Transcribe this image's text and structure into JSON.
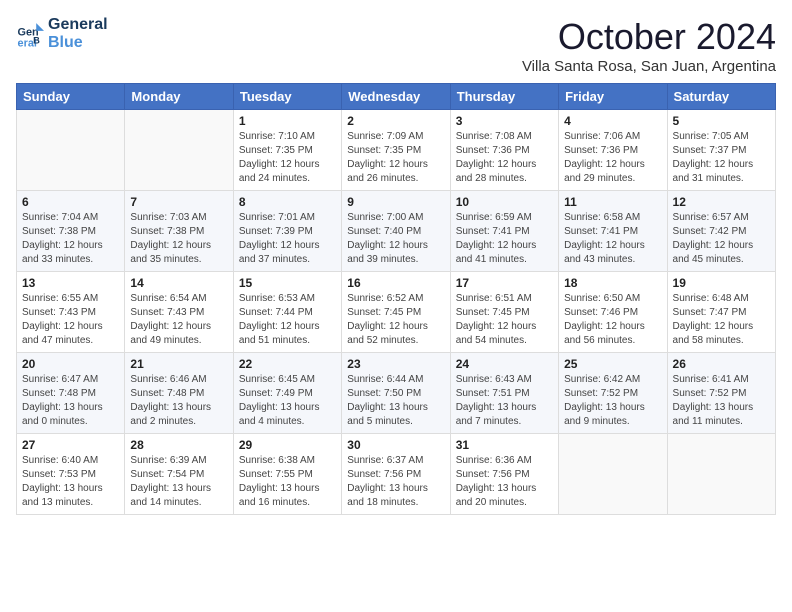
{
  "logo": {
    "line1": "General",
    "line2": "Blue"
  },
  "title": "October 2024",
  "location": "Villa Santa Rosa, San Juan, Argentina",
  "weekdays": [
    "Sunday",
    "Monday",
    "Tuesday",
    "Wednesday",
    "Thursday",
    "Friday",
    "Saturday"
  ],
  "weeks": [
    [
      {
        "day": "",
        "info": ""
      },
      {
        "day": "",
        "info": ""
      },
      {
        "day": "1",
        "info": "Sunrise: 7:10 AM\nSunset: 7:35 PM\nDaylight: 12 hours\nand 24 minutes."
      },
      {
        "day": "2",
        "info": "Sunrise: 7:09 AM\nSunset: 7:35 PM\nDaylight: 12 hours\nand 26 minutes."
      },
      {
        "day": "3",
        "info": "Sunrise: 7:08 AM\nSunset: 7:36 PM\nDaylight: 12 hours\nand 28 minutes."
      },
      {
        "day": "4",
        "info": "Sunrise: 7:06 AM\nSunset: 7:36 PM\nDaylight: 12 hours\nand 29 minutes."
      },
      {
        "day": "5",
        "info": "Sunrise: 7:05 AM\nSunset: 7:37 PM\nDaylight: 12 hours\nand 31 minutes."
      }
    ],
    [
      {
        "day": "6",
        "info": "Sunrise: 7:04 AM\nSunset: 7:38 PM\nDaylight: 12 hours\nand 33 minutes."
      },
      {
        "day": "7",
        "info": "Sunrise: 7:03 AM\nSunset: 7:38 PM\nDaylight: 12 hours\nand 35 minutes."
      },
      {
        "day": "8",
        "info": "Sunrise: 7:01 AM\nSunset: 7:39 PM\nDaylight: 12 hours\nand 37 minutes."
      },
      {
        "day": "9",
        "info": "Sunrise: 7:00 AM\nSunset: 7:40 PM\nDaylight: 12 hours\nand 39 minutes."
      },
      {
        "day": "10",
        "info": "Sunrise: 6:59 AM\nSunset: 7:41 PM\nDaylight: 12 hours\nand 41 minutes."
      },
      {
        "day": "11",
        "info": "Sunrise: 6:58 AM\nSunset: 7:41 PM\nDaylight: 12 hours\nand 43 minutes."
      },
      {
        "day": "12",
        "info": "Sunrise: 6:57 AM\nSunset: 7:42 PM\nDaylight: 12 hours\nand 45 minutes."
      }
    ],
    [
      {
        "day": "13",
        "info": "Sunrise: 6:55 AM\nSunset: 7:43 PM\nDaylight: 12 hours\nand 47 minutes."
      },
      {
        "day": "14",
        "info": "Sunrise: 6:54 AM\nSunset: 7:43 PM\nDaylight: 12 hours\nand 49 minutes."
      },
      {
        "day": "15",
        "info": "Sunrise: 6:53 AM\nSunset: 7:44 PM\nDaylight: 12 hours\nand 51 minutes."
      },
      {
        "day": "16",
        "info": "Sunrise: 6:52 AM\nSunset: 7:45 PM\nDaylight: 12 hours\nand 52 minutes."
      },
      {
        "day": "17",
        "info": "Sunrise: 6:51 AM\nSunset: 7:45 PM\nDaylight: 12 hours\nand 54 minutes."
      },
      {
        "day": "18",
        "info": "Sunrise: 6:50 AM\nSunset: 7:46 PM\nDaylight: 12 hours\nand 56 minutes."
      },
      {
        "day": "19",
        "info": "Sunrise: 6:48 AM\nSunset: 7:47 PM\nDaylight: 12 hours\nand 58 minutes."
      }
    ],
    [
      {
        "day": "20",
        "info": "Sunrise: 6:47 AM\nSunset: 7:48 PM\nDaylight: 13 hours\nand 0 minutes."
      },
      {
        "day": "21",
        "info": "Sunrise: 6:46 AM\nSunset: 7:48 PM\nDaylight: 13 hours\nand 2 minutes."
      },
      {
        "day": "22",
        "info": "Sunrise: 6:45 AM\nSunset: 7:49 PM\nDaylight: 13 hours\nand 4 minutes."
      },
      {
        "day": "23",
        "info": "Sunrise: 6:44 AM\nSunset: 7:50 PM\nDaylight: 13 hours\nand 5 minutes."
      },
      {
        "day": "24",
        "info": "Sunrise: 6:43 AM\nSunset: 7:51 PM\nDaylight: 13 hours\nand 7 minutes."
      },
      {
        "day": "25",
        "info": "Sunrise: 6:42 AM\nSunset: 7:52 PM\nDaylight: 13 hours\nand 9 minutes."
      },
      {
        "day": "26",
        "info": "Sunrise: 6:41 AM\nSunset: 7:52 PM\nDaylight: 13 hours\nand 11 minutes."
      }
    ],
    [
      {
        "day": "27",
        "info": "Sunrise: 6:40 AM\nSunset: 7:53 PM\nDaylight: 13 hours\nand 13 minutes."
      },
      {
        "day": "28",
        "info": "Sunrise: 6:39 AM\nSunset: 7:54 PM\nDaylight: 13 hours\nand 14 minutes."
      },
      {
        "day": "29",
        "info": "Sunrise: 6:38 AM\nSunset: 7:55 PM\nDaylight: 13 hours\nand 16 minutes."
      },
      {
        "day": "30",
        "info": "Sunrise: 6:37 AM\nSunset: 7:56 PM\nDaylight: 13 hours\nand 18 minutes."
      },
      {
        "day": "31",
        "info": "Sunrise: 6:36 AM\nSunset: 7:56 PM\nDaylight: 13 hours\nand 20 minutes."
      },
      {
        "day": "",
        "info": ""
      },
      {
        "day": "",
        "info": ""
      }
    ]
  ]
}
